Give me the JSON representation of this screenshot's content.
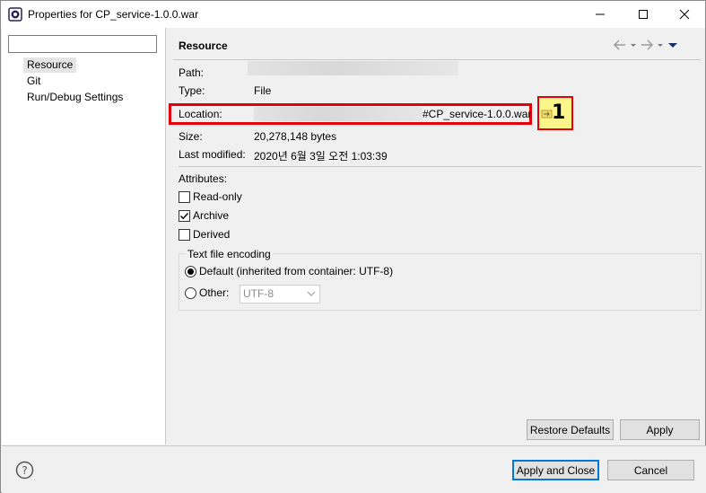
{
  "window": {
    "title": "Properties for CP_service-1.0.0.war",
    "minimize_icon": "minimize-icon",
    "maximize_icon": "maximize-icon",
    "close_icon": "close-icon"
  },
  "filter": {
    "value": "",
    "placeholder": ""
  },
  "tree": {
    "items": [
      {
        "label": "Resource",
        "selected": true
      },
      {
        "label": "Git",
        "selected": false
      },
      {
        "label": "Run/Debug Settings",
        "selected": false
      }
    ]
  },
  "resource_page": {
    "title": "Resource",
    "path_label": "Path:",
    "type_label": "Type:",
    "type_value": "File",
    "location_label": "Location:",
    "location_value_visible": "#CP_service-1.0.0.war",
    "size_label": "Size:",
    "size_value": "20,278,148  bytes",
    "modified_label": "Last modified:",
    "modified_value": "2020년 6월 3일 오전 1:03:39",
    "annotation_number": "1",
    "attributes_label": "Attributes:",
    "attributes": [
      {
        "label": "Read-only",
        "checked": false
      },
      {
        "label": "Archive",
        "checked": true
      },
      {
        "label": "Derived",
        "checked": false
      }
    ],
    "encoding": {
      "legend": "Text file encoding",
      "default_label": "Default (inherited from container: UTF-8)",
      "other_label": "Other:",
      "other_value": "UTF-8",
      "selected": "default"
    }
  },
  "buttons": {
    "restore_defaults": "Restore Defaults",
    "apply": "Apply",
    "apply_and_close": "Apply and Close",
    "cancel": "Cancel"
  },
  "colors": {
    "highlight_border": "#e2000b",
    "badge_fill": "#fbf58a",
    "default_button_border": "#0078d7"
  }
}
